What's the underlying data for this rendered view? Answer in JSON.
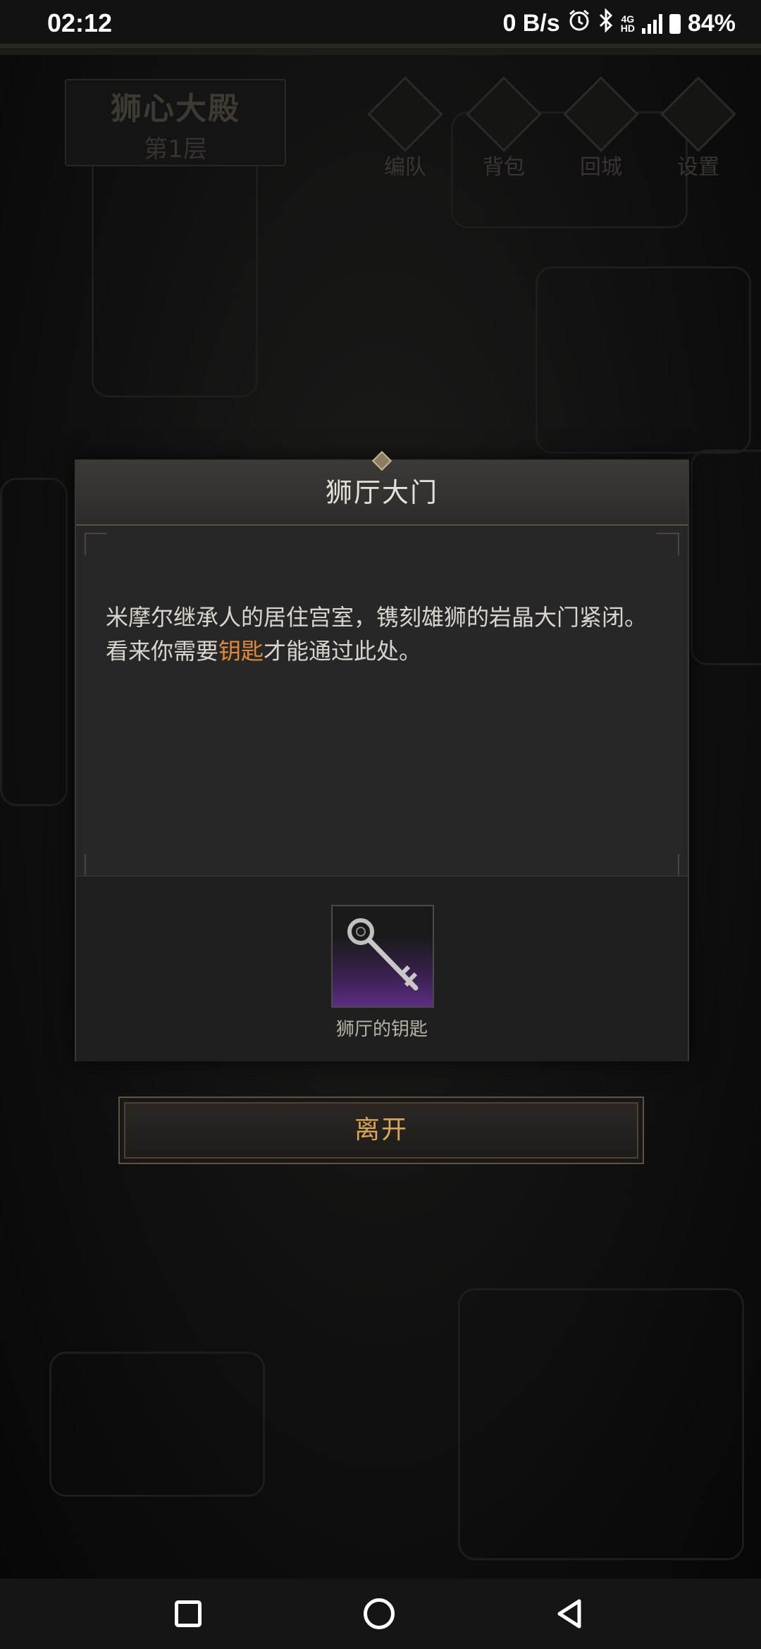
{
  "status_bar": {
    "time": "02:12",
    "net_speed": "0 B/s",
    "net_type_top": "4G",
    "net_type_bottom": "HD",
    "battery": "84%"
  },
  "location": {
    "title": "狮心大殿",
    "floor": "第1层"
  },
  "top_menu": [
    {
      "label": "编队",
      "icon": "helmet-icon"
    },
    {
      "label": "背包",
      "icon": "backpack-icon"
    },
    {
      "label": "回城",
      "icon": "door-icon"
    },
    {
      "label": "设置",
      "icon": "gear-icon"
    }
  ],
  "dialog": {
    "title": "狮厅大门",
    "text_part1": "米摩尔继承人的居住宫室，镌刻雄狮的岩晶大门紧闭。看来你需要",
    "text_highlight": "钥匙",
    "text_part2": "才能通过此处。",
    "required_item": {
      "name": "狮厅的钥匙",
      "icon": "key-icon"
    }
  },
  "leave_button": {
    "label": "离开"
  },
  "colors": {
    "highlight": "#e08a3a",
    "item_rarity": "#5b2d82",
    "button_text": "#d8a65a"
  }
}
